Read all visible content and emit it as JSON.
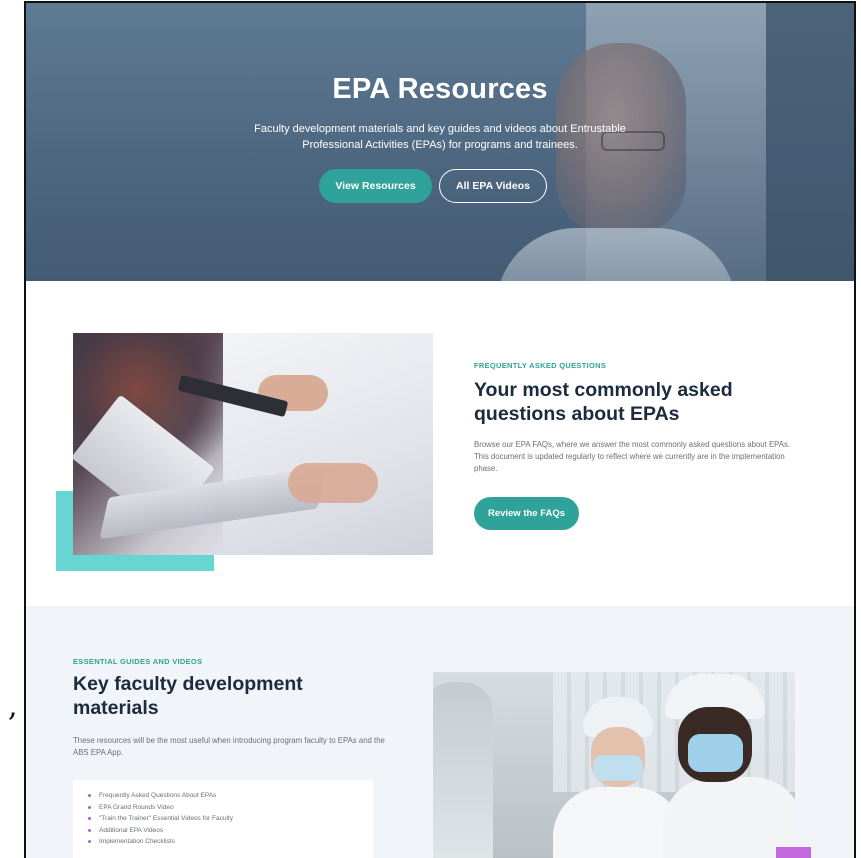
{
  "hero": {
    "title": "EPA Resources",
    "description": "Faculty development materials and key guides and videos about Entrustable Professional Activities (EPAs) for programs and trainees.",
    "primary_button": "View Resources",
    "secondary_button": "All EPA Videos"
  },
  "faq": {
    "eyebrow": "FREQUENTLY ASKED QUESTIONS",
    "title": "Your most commonly asked questions about EPAs",
    "body": "Browse our EPA FAQs, where we answer the most commonly asked questions about EPAs. This document is updated regularly to reflect where we currently are in the implementation phase.",
    "button": "Review the FAQs"
  },
  "guides": {
    "eyebrow": "ESSENTIAL GUIDES AND VIDEOS",
    "title": "Key faculty development materials",
    "body": "These resources will be the most useful when introducing program faculty to EPAs and the ABS EPA App.",
    "items": [
      "Frequently Asked Questions About EPAs",
      "EPA Grand Rounds Video",
      "\"Train the Trainer\" Essential Videos for Faculty",
      "Additional EPA Videos",
      "Implementation Checklists"
    ]
  },
  "margin_mark": ",",
  "colors": {
    "hero_overlay": "#4d6680",
    "accent_teal": "#2fa39a",
    "accent_cyan": "#67d6d3",
    "accent_purple": "#c468e0",
    "heading": "#1c2b3d",
    "guides_bg": "#f1f5f9"
  }
}
